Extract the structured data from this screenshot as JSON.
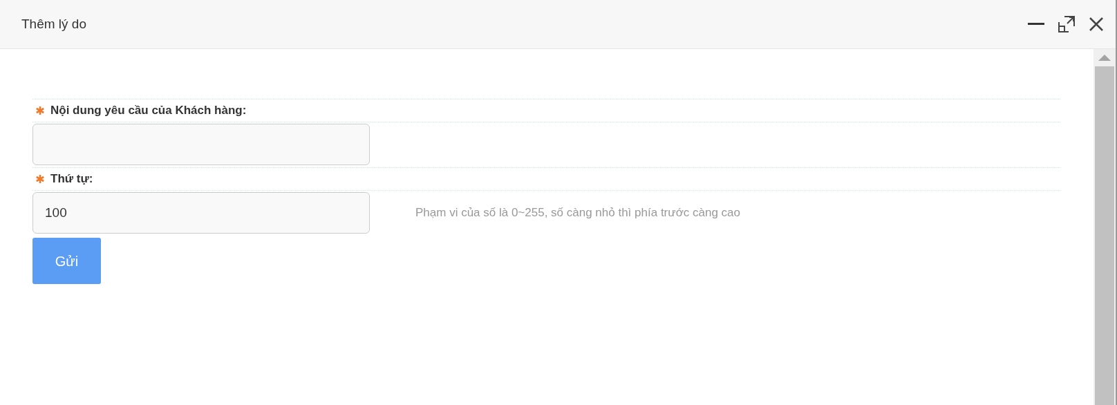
{
  "window": {
    "title": "Thêm lý do"
  },
  "fields": [
    {
      "label": "Nội dung yêu cầu của Khách hàng:",
      "required": true
    },
    {
      "label": "Thứ tự:",
      "required": true,
      "value": "100",
      "hint": "Phạm vi của số là 0~255, số càng nhỏ thì phía trước càng cao"
    }
  ],
  "submit_button": "Gửi"
}
